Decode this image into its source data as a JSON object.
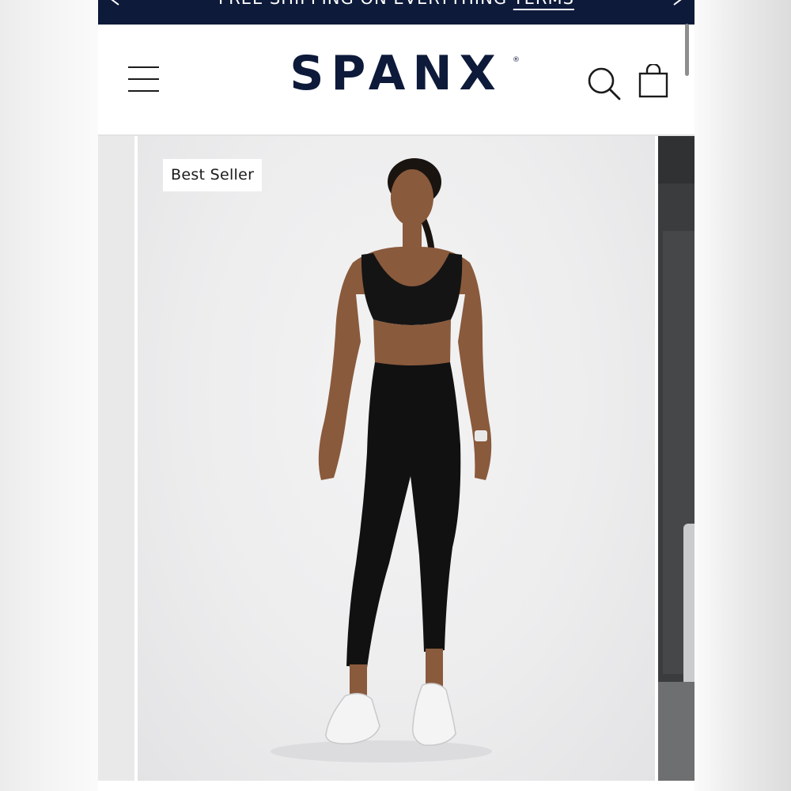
{
  "promo": {
    "message": "FREE SHIPPING ON EVERYTHING",
    "link_label": "TERMS",
    "prev_icon": "chevron-left-icon",
    "next_icon": "chevron-right-icon"
  },
  "header": {
    "menu_icon": "hamburger-menu-icon",
    "logo_text": "SPANX",
    "logo_mark": "®",
    "search_icon": "search-icon",
    "bag_icon": "shopping-bag-icon"
  },
  "carousel": {
    "badge": "Best Seller",
    "main_image": "model-in-black-sports-bra-and-leggings"
  },
  "colors": {
    "brand_navy": "#0d1a3a",
    "promo_bar": "#0d1a3a",
    "icon_dark": "#1b1b1b"
  }
}
